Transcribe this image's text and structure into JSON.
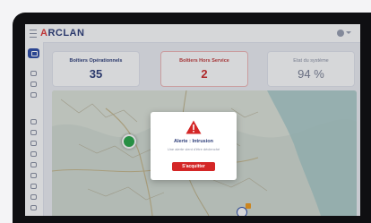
{
  "app": {
    "logo_prefix": "A",
    "logo_rest": "RCLAN"
  },
  "cards": [
    {
      "title": "Boîtiers Opérationnels",
      "value": "35"
    },
    {
      "title": "Boîtiers Hors Service",
      "value": "2"
    },
    {
      "title": "Etat du système",
      "value": "94 %"
    }
  ],
  "modal": {
    "title": "Alerte : Intrusion",
    "text": "Une alerte vient d'être déclenché",
    "button": "S'acquitter"
  },
  "colors": {
    "brand": "#2f3f7a",
    "alert": "#d42626",
    "sidebar_active": "#2f4ea8"
  },
  "icons": {
    "menu": "hamburger-icon",
    "user": "user-icon",
    "warning": "warning-triangle-icon",
    "marker_ok": "green-marker-icon",
    "marker_alert": "alert-marker-icon"
  }
}
